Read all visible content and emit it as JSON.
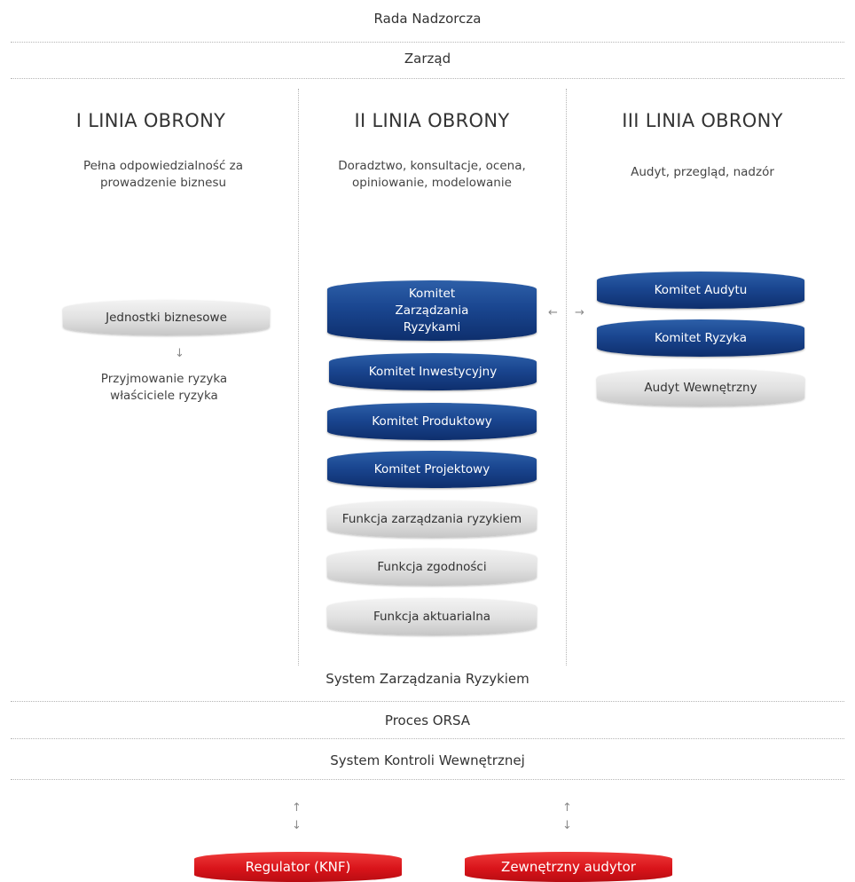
{
  "top": {
    "rada": "Rada Nadzorcza",
    "zarzad": "Zarząd"
  },
  "columns": [
    {
      "title": "I LINIA OBRONY",
      "desc": "Pełna odpowiedzialność za prowadzenie biznesu",
      "boxes": [
        "Jednostki biznesowe"
      ],
      "note": "Przyjmowanie ryzyka właściciele ryzyka"
    },
    {
      "title": "II LINIA OBRONY",
      "desc": "Doradztwo, konsultacje, ocena, opiniowanie, modelowanie",
      "boxes": [
        "Komitet Zarządzania Ryzykami",
        "Komitet Inwestycyjny",
        "Komitet Produktowy",
        "Komitet Projektowy",
        "Funkcja zarządzania ryzykiem",
        "Funkcja zgodności",
        "Funkcja aktuarialna"
      ]
    },
    {
      "title": "III LINIA OBRONY",
      "desc": "Audyt, przegląd, nadzór",
      "boxes": [
        "Komitet Audytu",
        "Komitet Ryzyka",
        "Audyt Wewnętrzny"
      ]
    }
  ],
  "bottom": {
    "system_zarzadzania": "System Zarządzania Ryzykiem",
    "orsa": "Proces ORSA",
    "kontrola": "System Kontroli Wewnętrznej",
    "regulator": "Regulator (KNF)",
    "audytor": "Zewnętrzny audytor"
  },
  "icons": {
    "arrow_left": "←",
    "arrow_right": "→",
    "arrow_up": "↑",
    "arrow_down": "↓"
  },
  "colors": {
    "blue": "#1a4690",
    "grey": "#e0e0e0",
    "red": "#d9141a"
  }
}
